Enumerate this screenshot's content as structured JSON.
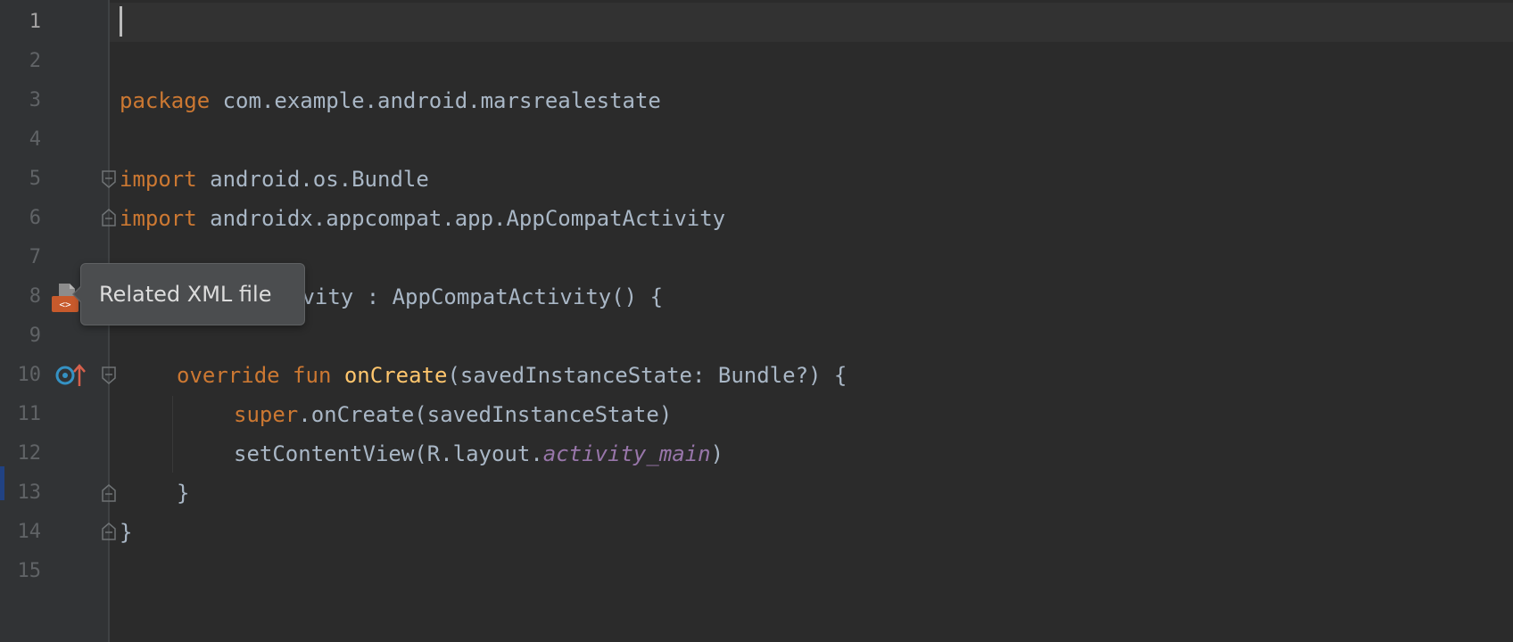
{
  "editor": {
    "tooltip": "Related XML file",
    "line_numbers": [
      "1",
      "2",
      "3",
      "4",
      "5",
      "6",
      "7",
      "8",
      "9",
      "10",
      "11",
      "12",
      "13",
      "14",
      "15"
    ],
    "lines": {
      "l3": {
        "kw": "package",
        "rest": " com.example.android.marsrealestate"
      },
      "l5": {
        "kw": "import",
        "rest": " android.os.Bundle"
      },
      "l6": {
        "kw": "import",
        "rest": " androidx.appcompat.app.AppCompatActivity"
      },
      "l8": {
        "rest": "ivity : AppCompatActivity() {"
      },
      "l10": {
        "kw1": "override",
        "kw2": " fun ",
        "fn": "onCreate",
        "rest": "(savedInstanceState: Bundle?) {"
      },
      "l11": {
        "kw": "super",
        "rest": ".onCreate(savedInstanceState)"
      },
      "l12": {
        "pre": "setContentView(R.layout.",
        "it": "activity_main",
        "post": ")"
      },
      "l13": {
        "text": "}"
      },
      "l14": {
        "text": "}"
      }
    },
    "icons": {
      "xml": "related-xml-file-icon",
      "override": "overrides-method-icon",
      "fold": "fold-marker-icon"
    },
    "colors": {
      "background": "#2b2b2b",
      "keyword": "#cc7832",
      "function": "#ffc66d",
      "identifier": "#a9b7c6",
      "italic_field": "#9876aa"
    }
  }
}
